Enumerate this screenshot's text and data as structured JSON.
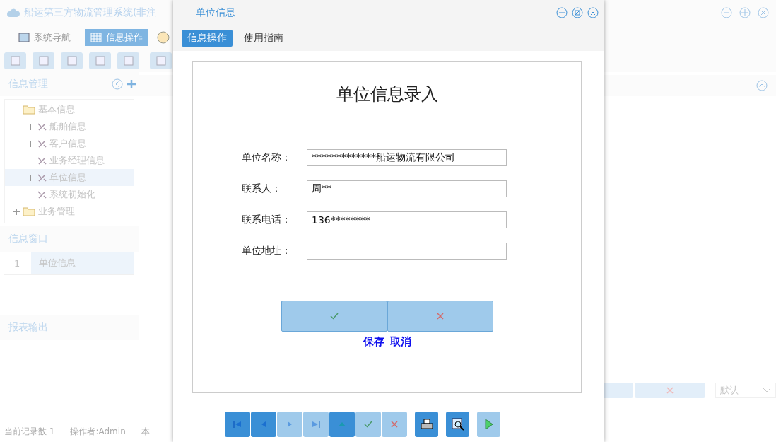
{
  "app": {
    "title": "船运第三方物流管理系统(非注",
    "nav_tabs": [
      {
        "label": "系统导航",
        "selected": false
      },
      {
        "label": "信息操作",
        "selected": true
      }
    ],
    "tree_panel": {
      "title": "信息管理",
      "items": [
        {
          "label": "基本信息",
          "expanded": true,
          "selected": false,
          "children": [
            {
              "label": "船舶信息",
              "expanded": false,
              "selected": false
            },
            {
              "label": "客户信息",
              "expanded": false,
              "selected": false
            },
            {
              "label": "业务经理信息",
              "selected": false
            },
            {
              "label": "单位信息",
              "expanded": false,
              "selected": true
            },
            {
              "label": "系统初始化",
              "selected": false
            }
          ]
        },
        {
          "label": "业务管理",
          "expanded": false,
          "selected": false
        }
      ]
    },
    "window_panel": {
      "title": "信息窗口",
      "rows": [
        {
          "index": "1",
          "name": "单位信息"
        }
      ]
    },
    "report_panel": {
      "title": "报表输出"
    },
    "status_bar": [
      "当前记录数 1",
      "操作者:Admin",
      "本"
    ],
    "select": {
      "value": "默认"
    }
  },
  "dialog": {
    "title": "单位信息",
    "tabs": [
      {
        "label": "信息操作",
        "selected": true
      },
      {
        "label": "使用指南",
        "selected": false
      }
    ],
    "form": {
      "heading": "单位信息录入",
      "fields": [
        {
          "label": "单位名称：",
          "value": "*************船运物流有限公司"
        },
        {
          "label": "联系人：",
          "value": "周**"
        },
        {
          "label": "联系电话：",
          "value": "136********"
        },
        {
          "label": "单位地址："
        }
      ],
      "actions": [
        {
          "kind": "confirm",
          "label": "保存"
        },
        {
          "kind": "cancel",
          "label": "取消"
        }
      ]
    },
    "nav_buttons": [
      {
        "kind": "first",
        "disabled": false
      },
      {
        "kind": "prev",
        "disabled": false
      },
      {
        "kind": "next",
        "disabled": true
      },
      {
        "kind": "last",
        "disabled": true
      },
      {
        "kind": "up",
        "disabled": false
      },
      {
        "kind": "confirm",
        "disabled": true
      },
      {
        "kind": "cancel",
        "disabled": true
      },
      {
        "kind": "print",
        "disabled": false
      },
      {
        "kind": "preview",
        "disabled": false
      },
      {
        "kind": "run",
        "disabled": true
      }
    ]
  }
}
